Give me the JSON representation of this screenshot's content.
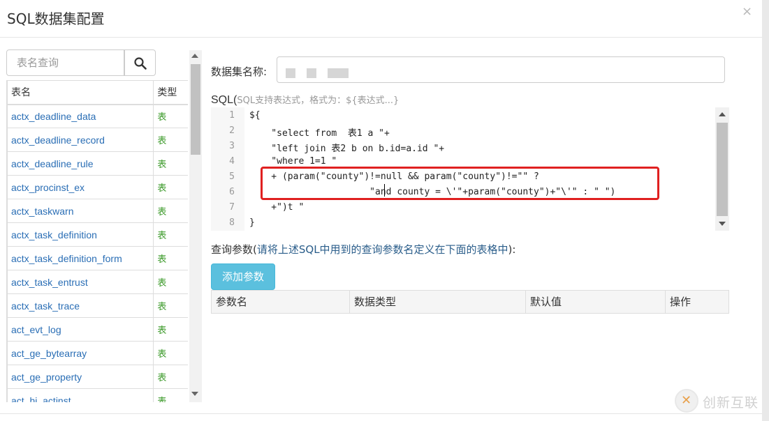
{
  "dialog": {
    "title": "SQL数据集配置",
    "close_symbol": "×"
  },
  "search": {
    "placeholder": "表名查询"
  },
  "table": {
    "headers": {
      "name": "表名",
      "type": "类型"
    },
    "rows": [
      {
        "name": "actx_deadline_data",
        "type": "表"
      },
      {
        "name": "actx_deadline_record",
        "type": "表"
      },
      {
        "name": "actx_deadline_rule",
        "type": "表"
      },
      {
        "name": "actx_procinst_ex",
        "type": "表"
      },
      {
        "name": "actx_taskwarn",
        "type": "表"
      },
      {
        "name": "actx_task_definition",
        "type": "表"
      },
      {
        "name": "actx_task_definition_form",
        "type": "表"
      },
      {
        "name": "actx_task_entrust",
        "type": "表"
      },
      {
        "name": "actx_task_trace",
        "type": "表"
      },
      {
        "name": "act_evt_log",
        "type": "表"
      },
      {
        "name": "act_ge_bytearray",
        "type": "表"
      },
      {
        "name": "act_ge_property",
        "type": "表"
      },
      {
        "name": "act_hi_actinst",
        "type": "表"
      }
    ]
  },
  "dataset": {
    "label": "数据集名称:",
    "value": ""
  },
  "sql": {
    "label": "SQL(",
    "hint": "SQL支持表达式，格式为：${表达式...}",
    "lines": [
      {
        "num": "1",
        "text": "${"
      },
      {
        "num": "2",
        "text": "    \"select from  表1 a \"+"
      },
      {
        "num": "3",
        "text": "    \"left join 表2 b on b.id=a.id \"+"
      },
      {
        "num": "4",
        "text": "    \"where 1=1 \""
      },
      {
        "num": "5",
        "text": "    + (param(\"county\")!=null && param(\"county\")!=\"\" ?"
      },
      {
        "num": "6",
        "text": "                      \"and county = \\'\"+param(\"county\")+\"\\'\" : \" \")"
      },
      {
        "num": "7",
        "text": "    +\")t \""
      },
      {
        "num": "8",
        "text": "}"
      }
    ]
  },
  "params": {
    "label": "查询参数(",
    "hint": "请将上述SQL中用到的查询参数名定义在下面的表格中",
    "label_end": "):",
    "add_button": "添加参数",
    "headers": [
      "参数名",
      "数据类型",
      "默认值",
      "操作"
    ]
  },
  "watermark": {
    "text": "创新互联"
  },
  "colors": {
    "link": "#2a6eb5",
    "type_green": "#3c9a2a",
    "button_info": "#5bc0de",
    "highlight_red": "#e02020"
  }
}
